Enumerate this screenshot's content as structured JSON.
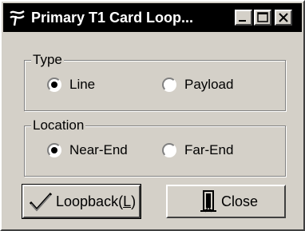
{
  "window": {
    "title": "Primary T1 Card Loop...",
    "icon": "squiggle-app-icon",
    "controls": {
      "minimize": "minimize-icon",
      "maximize": "maximize-icon",
      "close": "close-x-icon"
    }
  },
  "type_group": {
    "legend": "Type",
    "options": [
      {
        "label": "Line",
        "selected": true
      },
      {
        "label": "Payload",
        "selected": false
      }
    ]
  },
  "location_group": {
    "legend": "Location",
    "options": [
      {
        "label": "Near-End",
        "selected": true
      },
      {
        "label": "Far-End",
        "selected": false
      }
    ]
  },
  "buttons": {
    "loopback": {
      "label": "Loopback(",
      "accel": "L",
      "close_paren": ")",
      "icon": "checkmark-icon"
    },
    "close": {
      "label": "Close",
      "icon": "door-exit-icon"
    }
  }
}
